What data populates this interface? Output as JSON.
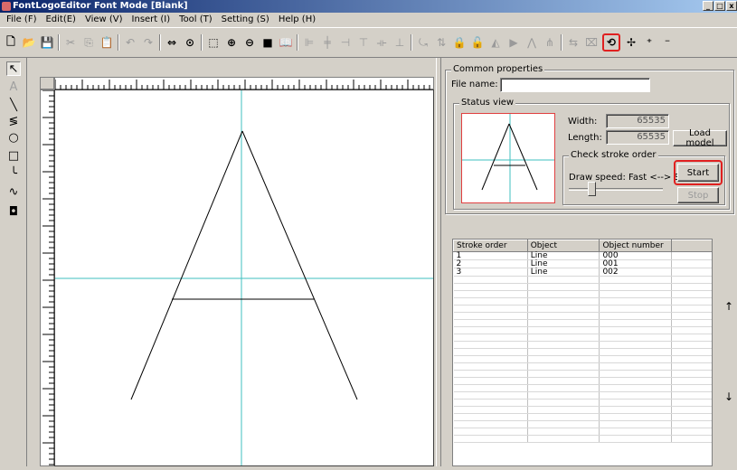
{
  "window": {
    "title": "FontLogoEditor Font Mode [Blank]",
    "controls": [
      "_",
      "□",
      "x"
    ]
  },
  "menu": [
    "File (F)",
    "Edit(E)",
    "View (V)",
    "Insert (I)",
    "Tool (T)",
    "Setting (S)",
    "Help (H)"
  ],
  "toolbar": [
    {
      "icon": "new-icon",
      "glyph": "🗋",
      "style": "dark"
    },
    {
      "icon": "open-icon",
      "glyph": "📂",
      "style": "dark"
    },
    {
      "icon": "save-icon",
      "glyph": "💾",
      "style": "dark"
    },
    {
      "sep": true
    },
    {
      "icon": "cut-icon",
      "glyph": "✂",
      "style": "gray"
    },
    {
      "icon": "copy-icon",
      "glyph": "⎘",
      "style": "gray"
    },
    {
      "icon": "paste-icon",
      "glyph": "📋",
      "style": "dark"
    },
    {
      "sep": true
    },
    {
      "icon": "undo-icon",
      "glyph": "↶",
      "style": "gray"
    },
    {
      "icon": "redo-icon",
      "glyph": "↷",
      "style": "gray"
    },
    {
      "sep": true
    },
    {
      "icon": "fit-width-icon",
      "glyph": "⇔",
      "style": "dark"
    },
    {
      "icon": "zoom-icon",
      "glyph": "⊙",
      "style": "dark"
    },
    {
      "sep": true
    },
    {
      "icon": "select-region-icon",
      "glyph": "⬚",
      "style": "dark"
    },
    {
      "icon": "zoom-in-icon",
      "glyph": "⊕",
      "style": "dark"
    },
    {
      "icon": "zoom-out-icon",
      "glyph": "⊖",
      "style": "dark"
    },
    {
      "icon": "stop-icon",
      "glyph": "■",
      "style": "dark"
    },
    {
      "icon": "book-icon",
      "glyph": "📖",
      "style": "dark"
    },
    {
      "sep": true
    },
    {
      "icon": "align-left-icon",
      "glyph": "⊫",
      "style": "gray"
    },
    {
      "icon": "align-center-icon",
      "glyph": "╪",
      "style": "gray"
    },
    {
      "icon": "align-right-icon",
      "glyph": "⊣",
      "style": "gray"
    },
    {
      "icon": "align-top-icon",
      "glyph": "⊤",
      "style": "gray"
    },
    {
      "icon": "align-middle-icon",
      "glyph": "⟛",
      "style": "gray"
    },
    {
      "icon": "align-bottom-icon",
      "glyph": "⊥",
      "style": "gray"
    },
    {
      "sep": true
    },
    {
      "icon": "rotate-icon",
      "glyph": "⤿",
      "style": "gray"
    },
    {
      "icon": "flip-icon",
      "glyph": "⇅",
      "style": "gray"
    },
    {
      "icon": "lock-icon",
      "glyph": "🔒",
      "style": "dark"
    },
    {
      "icon": "unlock-icon",
      "glyph": "🔓",
      "style": "dark"
    },
    {
      "icon": "flip-h-icon",
      "glyph": "◭",
      "style": "gray"
    },
    {
      "icon": "play-icon",
      "glyph": "▶",
      "style": "gray"
    },
    {
      "icon": "mirror-icon",
      "glyph": "⋀",
      "style": "gray"
    },
    {
      "icon": "mirror-v-icon",
      "glyph": "⋔",
      "style": "gray"
    },
    {
      "sep": true
    },
    {
      "icon": "connect-icon",
      "glyph": "⇆",
      "style": "gray"
    },
    {
      "icon": "stroke-order-list-icon",
      "glyph": "⌧",
      "style": "gray"
    },
    {
      "icon": "stroke-order-icon",
      "glyph": "⟲",
      "style": "dark",
      "highlight": true
    },
    {
      "icon": "add-point-icon",
      "glyph": "✢",
      "style": "dark"
    },
    {
      "icon": "insert-point-icon",
      "glyph": "⁺",
      "style": "dark"
    },
    {
      "icon": "delete-point-icon",
      "glyph": "⁻",
      "style": "dark"
    }
  ],
  "left_tools": [
    {
      "icon": "select-arrow-icon",
      "glyph": "↖",
      "selected": true
    },
    {
      "icon": "text-a-icon",
      "glyph": "A",
      "gray": true
    },
    {
      "icon": "line-tool-icon",
      "glyph": "╲"
    },
    {
      "icon": "freehand-tool-icon",
      "glyph": "≶"
    },
    {
      "icon": "circle-tool-icon",
      "glyph": "○"
    },
    {
      "icon": "rectangle-tool-icon",
      "glyph": "□"
    },
    {
      "icon": "arc-tool-icon",
      "glyph": "╰"
    },
    {
      "icon": "curve-tool-icon",
      "glyph": "∿"
    },
    {
      "icon": "fill-tool-icon",
      "glyph": "◘"
    }
  ],
  "properties": {
    "group_title": "Common properties",
    "file_name_label": "File name:",
    "file_name_value": "",
    "status_view_title": "Status view",
    "width_label": "Width:",
    "width_value": "65535",
    "length_label": "Length:",
    "length_value": "65535",
    "load_model_label": "Load model",
    "check_stroke_title": "Check stroke order",
    "draw_speed_label": "Draw speed:  Fast <--> Slow",
    "draw_speed_level": 0.25,
    "start_label": "Start",
    "stop_label": "Stop"
  },
  "stroke_table": {
    "headers": [
      "Stroke order",
      "Object",
      "Object number",
      ""
    ],
    "rows": [
      [
        "1",
        "Line",
        "000",
        ""
      ],
      [
        "2",
        "Line",
        "001",
        ""
      ],
      [
        "3",
        "Line",
        "002",
        ""
      ]
    ]
  },
  "nav_arrows": {
    "up": "↑",
    "down": "↓"
  },
  "colors": {
    "guide": "#3fbfbf",
    "highlight": "#e02020",
    "title_start": "#0a246a"
  }
}
